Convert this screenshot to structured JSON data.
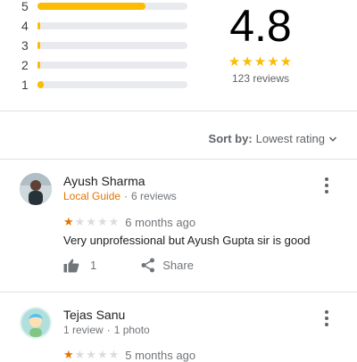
{
  "summary": {
    "distribution": [
      {
        "label": "5",
        "fraction": 0.72
      },
      {
        "label": "4",
        "fraction": 0.02
      },
      {
        "label": "3",
        "fraction": 0.02
      },
      {
        "label": "2",
        "fraction": 0.01
      },
      {
        "label": "1",
        "fraction": 0.04
      }
    ],
    "bar_color": "#fbbc04",
    "track_color": "#e8eaed",
    "rating": "4.8",
    "stars": "★★★★★",
    "star_color": "#fbbc04",
    "review_count": "123 reviews"
  },
  "sort": {
    "label": "Sort by:",
    "value": "Lowest rating"
  },
  "reviews": [
    {
      "name": "Ayush Sharma",
      "badge": "Local Guide",
      "separator": "·",
      "stats": "6 reviews",
      "rating_value": 1,
      "stars_on": "★",
      "stars_off": "★★★★",
      "when": "6 months ago",
      "text": "Very unprofessional but Ayush Gupta sir is good",
      "likes": "1",
      "share_label": "Share"
    },
    {
      "name": "Tejas Sanu",
      "stats": "1 review",
      "separator": "·",
      "stats2": "1 photo",
      "rating_value": 1,
      "stars_on": "★",
      "stars_off": "★★★★",
      "when": "5 months ago"
    }
  ],
  "icons": {
    "more": "more-vert-icon",
    "thumb": "thumbs-up-icon",
    "share": "share-icon",
    "chevron": "chevron-down-icon"
  }
}
